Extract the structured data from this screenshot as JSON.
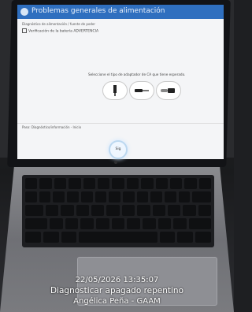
{
  "screen": {
    "window_title": "Problemas generales de alimentación",
    "line1": "Diagnóstico de alimentación / fuente de poder",
    "line2": "Verificación de la batería ADVERTENCIA",
    "instruction": "Seleccione el tipo de adaptador de CA que tiene esperado.",
    "bottom_text": "Paso: Diagnóstico/información - Inicio",
    "next_label": "Sig"
  },
  "overlay": {
    "datetime": "22/05/2026 13:35:07",
    "caption": "Diagnosticar apagado repentino",
    "author": "Angélica Peña - GAAM"
  }
}
